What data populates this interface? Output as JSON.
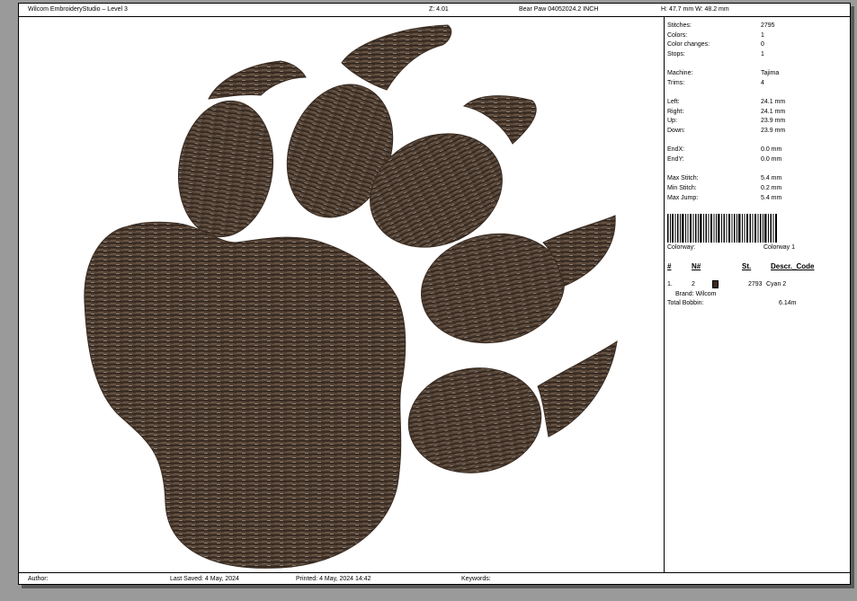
{
  "header": {
    "app_title": "Wilcom EmbroideryStudio – Level 3",
    "zoom": "Z: 4.01",
    "design": "Bear Paw  04052024.2  INCH",
    "dimensions": "H: 47.7 mm   W: 48.2 mm"
  },
  "stats": {
    "stitches": {
      "label": "Stitches:",
      "value": "2795"
    },
    "colors": {
      "label": "Colors:",
      "value": "1"
    },
    "color_changes": {
      "label": "Color changes:",
      "value": "0"
    },
    "stops": {
      "label": "Stops:",
      "value": "1"
    },
    "machine": {
      "label": "Machine:",
      "value": "Tajima"
    },
    "trims": {
      "label": "Trims:",
      "value": "4"
    },
    "left": {
      "label": "Left:",
      "value": "24.1 mm"
    },
    "right": {
      "label": "Right:",
      "value": "24.1 mm"
    },
    "up": {
      "label": "Up:",
      "value": "23.9 mm"
    },
    "down": {
      "label": "Down:",
      "value": "23.9 mm"
    },
    "endx": {
      "label": "EndX:",
      "value": "0.0 mm"
    },
    "endy": {
      "label": "EndY:",
      "value": "0.0 mm"
    },
    "max_stitch": {
      "label": "Max Stitch:",
      "value": "5.4 mm"
    },
    "min_stitch": {
      "label": "Min Stitch:",
      "value": "0.2 mm"
    },
    "max_jump": {
      "label": "Max Jump:",
      "value": "5.4 mm"
    }
  },
  "colorway": {
    "label": "Colorway:",
    "value": "Colorway 1"
  },
  "color_table": {
    "headers": {
      "num": "#",
      "needle": "N#",
      "stitches": "St.",
      "descr": "Descr._Code"
    },
    "rows": [
      {
        "num": "1.",
        "needle": "2",
        "swatch": "#3b2a20",
        "stitches": "2793",
        "descr": "Cyan 2",
        "brand": "Brand: Wilcom"
      }
    ]
  },
  "bobbin": {
    "label": "Total Bobbin:",
    "value": "6.14m"
  },
  "footer": {
    "author": "Author:",
    "last_saved": "Last Saved:  4 May, 2024",
    "printed": "Printed:   4 May, 2024 14:42",
    "keywords": "Keywords:"
  },
  "colors": {
    "thread": "#4a3a2e",
    "thread_dark": "#2e231b",
    "thread_light": "#8a7665",
    "background": "#9a9a9a",
    "sheet": "#ffffff"
  }
}
